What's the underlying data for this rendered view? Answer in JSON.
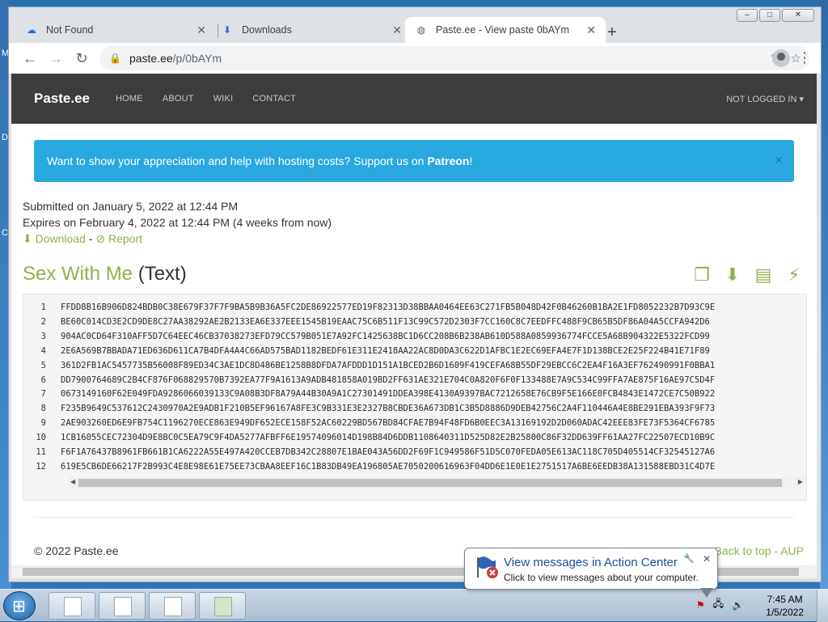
{
  "desktop": {
    "left_letters": [
      "M",
      "D",
      "C"
    ]
  },
  "window_controls": {
    "minimize": "–",
    "maximize": "□",
    "close": "✕"
  },
  "tabs": [
    {
      "title": "Not Found",
      "icon": "cloud-icon"
    },
    {
      "title": "Downloads",
      "icon": "download-icon"
    },
    {
      "title": "Paste.ee - View paste 0bAYm",
      "icon": "globe-icon"
    }
  ],
  "new_tab": "+",
  "address_bar": {
    "domain": "paste.ee",
    "path": "/p/0bAYm"
  },
  "site_nav": {
    "brand": "Paste.ee",
    "links": [
      "HOME",
      "ABOUT",
      "WIKI",
      "CONTACT"
    ],
    "account": "NOT LOGGED IN ▾"
  },
  "alert": {
    "text": "Want to show your appreciation and help with hosting costs? Support us on ",
    "link": "Patreon",
    "suffix": "!",
    "close": "×"
  },
  "meta": {
    "submitted": "Submitted on January 5, 2022 at 12:44 PM",
    "expires": "Expires on February 4, 2022 at 12:44 PM (4 weeks from now)",
    "download": "Download",
    "separator": "-",
    "report": "Report"
  },
  "paste": {
    "name": "Sex With Me",
    "type": "(Text)",
    "lines": [
      "FFDD8B16B906D824BDB0C38E679F37F7F9BA5B9B36A5FC2DE86922577ED19F82313D38BBAA0464EE63C271FB5B048D42F0B46260B1BA2E1FD8052232B7D93C9E",
      "BE60C014CD3E2CD9DE8C27AA38292AE2B2133EA6E337EEE1545B19EAAC75C6B511F13C99C572D2303F7CC160C8C7EEDFFC488F9CB65B5DF86A04A5CCFA942D6",
      "904AC0CD64F310AFF5D7C64EEC46CB37038273EFD79CC579B051E7A92FC1425638BC1D6CC208B6B238AB610D588A0859936774FCCE5A68B904322E5322FCD99",
      "2E6A569B7BBADA71ED636D611CA7B4DFA4A4C66AD575BAD1182BEDF61E311E2418AA22AC8D0DA3C622D1AFBC1E2EC69EFA4E7F1D138BCE2E25F224B41E71F89",
      "361D2FB1AC5457735B56008F89ED34C3AE1DC8D486BE1258B8DFDA7AFDDD1D151A1BCED2B6D1609F419CEFA68B55DF29EBCC6C2EA4F16A3EF762490991F0BBA1",
      "DD7900764689C2B4CF876F068829570B7392EA77F9A1613A9ADB481858A019BD2FF631AE321E704C0A820F6F0F133488E7A9C534C99FFA7AE875F16AE97C5D4F",
      "0673149160F62E049FDA9286066039133C9A08B3DF8A79A44B30A9A1C27301491DDEA398E4130A9397BAC7212658E76CB9F5E166E0FCB4843E1472CE7C50B922",
      "F235B9649C537612C2430970A2E9ADB1F210B5EF96167A8FE3C9B331E3E2327B8CBDE36A673DB1C3B5D8886D9DEB42756C2A4F110446A4E8BE291EBA393F9F73",
      "2AE903260ED6E9FB754C1196270ECE863E949DF652ECE158F52AC60229BD567BD84CFAE7B94F48FD6B0EEC3A13169192D2D060ADAC42EEE83FE73F5364CF6785",
      "1CB16055CEC72304D9E8BC0C5EA79C9F4DA5277AFBFF6E19574096014D198B84D6DDB1108640311D525D82E2B25800C86F32DD639FF61AA27FC22507ECD10B9C",
      "F6F1A76437B8961FB661B1CA6222A55E497A420CCEB7DB342C28807E1BAE043A56DD2F69F1C949586F51D5C070FEDA05E613AC118C705D405514CF32545127A6",
      "619E5CB6DE66217F2B993C4E8E98E61E75EE73CBAA8EEF16C1B83DB49EA196805AE7050200616963F04DD6E1E0E1E2751517A6BE6EEDB38A131588EBD31C4D7E"
    ]
  },
  "footer": {
    "copyright": "© 2022 Paste.ee",
    "back_to_top": "Back to top",
    "separator": "-",
    "aup": "AUP"
  },
  "notification": {
    "title": "View messages in Action Center",
    "body": "Click to view messages about your computer.",
    "close": "✕"
  },
  "clock": {
    "time": "7:45 AM",
    "date": "1/5/2022"
  }
}
